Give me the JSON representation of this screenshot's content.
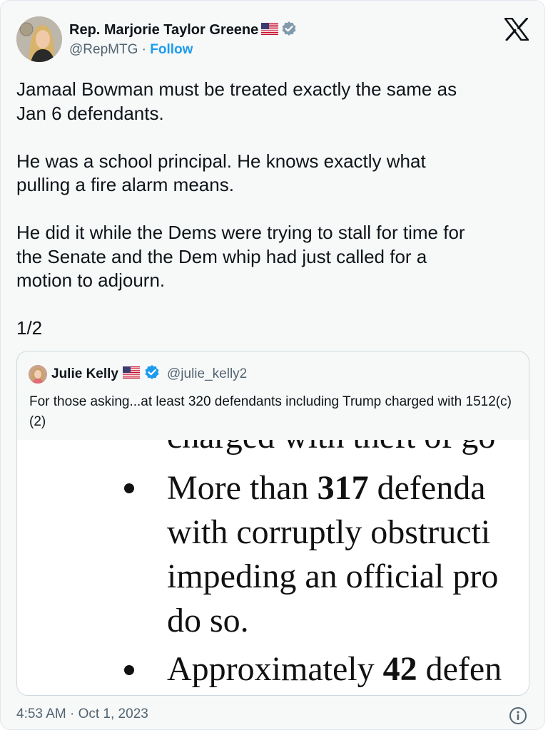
{
  "author": {
    "name": "Rep. Marjorie Taylor Greene",
    "handle": "@RepMTG",
    "separator": "·",
    "follow_label": "Follow",
    "flag_icon": "us-flag-icon",
    "verified_icon": "verified-gray-icon"
  },
  "tweet": {
    "text": "Jamaal Bowman must be treated exactly the same as\nJan 6 defendants.\n\nHe was a school principal. He knows exactly what\npulling a fire alarm means.\n\nHe did it while the Dems were trying to stall for time for\nthe Senate and the Dem whip had just called for a\nmotion to adjourn.\n\n1/2"
  },
  "quote": {
    "name": "Julie Kelly",
    "handle": "@julie_kelly2",
    "flag_icon": "us-flag-icon",
    "verified_icon": "verified-blue-icon",
    "text": "For those asking...at least 320 defendants including Trump charged with 1512(c)(2)",
    "image": {
      "line_cut": "charged with theft of go",
      "bullet1_line1_pre": "More than ",
      "bullet1_line1_num": "317",
      "bullet1_line1_post": " defenda",
      "bullet1_line2": "with corruptly obstructi",
      "bullet1_line3": "impeding an official pro",
      "bullet1_line4": "do so.",
      "bullet2_pre": "Approximately ",
      "bullet2_num": "42",
      "bullet2_post": " defen"
    }
  },
  "footer": {
    "timestamp": "4:53 AM · Oct 1, 2023"
  },
  "colors": {
    "accent": "#1d9bf0",
    "muted": "#536471",
    "text": "#0f1419"
  }
}
